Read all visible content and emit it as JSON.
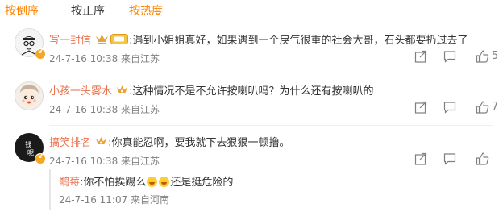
{
  "sort_tabs": [
    {
      "label": "按倒序",
      "active": true
    },
    {
      "label": "按正序",
      "active": false
    },
    {
      "label": "按热度",
      "active": true
    }
  ],
  "comments": [
    {
      "username": "写一封信",
      "text": ":遇到小姐姐真好，如果遇到一个戾气很重的社会大哥，石头都要扔过去了",
      "meta": "24-7-16 10:38 来自江苏",
      "likes": "5"
    },
    {
      "username": "小孩一头雾水",
      "text": ":这种情况不是不允许按喇叭吗？为什么还有按喇叭的",
      "meta": "24-7-16 10:38 来自江苏",
      "likes": "7"
    },
    {
      "username": "搞笑排名",
      "text": ":你真能忍啊，要我就下去狠狠一顿撸。",
      "meta": "24-7-16 10:38 来自江苏",
      "likes": "",
      "avatar_text": "钱\n呢"
    }
  ],
  "reply": {
    "username": "鹬莓",
    "text_before": ":你不怕挨踢么",
    "text_after": "还是挺危险的",
    "meta": "24-7-16 11:07 来自河南"
  },
  "colors": {
    "accent": "#ff8200",
    "username": "#eb7350",
    "meta": "#808080"
  },
  "icons": [
    "share-icon",
    "comment-icon",
    "like-icon",
    "laughing-emoji-icon",
    "vip-badge-icon",
    "gold-medal-icon"
  ]
}
